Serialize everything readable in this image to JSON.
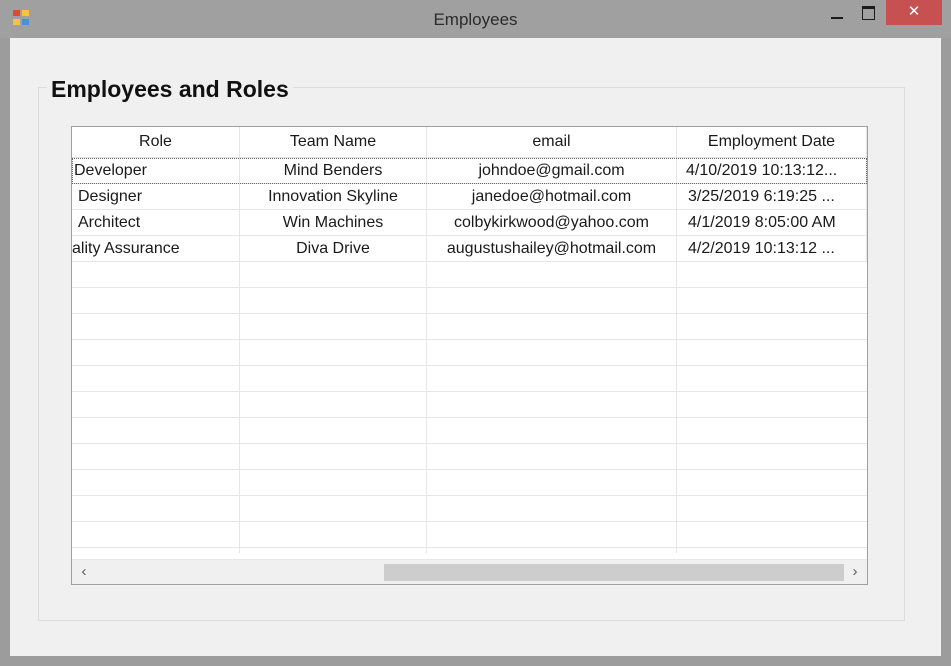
{
  "window": {
    "title": "Employees",
    "close_glyph": "✕",
    "icon": "app-window-icon"
  },
  "group": {
    "title": "Employees and Roles"
  },
  "grid": {
    "columns": [
      "Role",
      "Team Name",
      "email",
      "Employment Date"
    ],
    "rows": [
      [
        "Developer",
        "Mind Benders",
        "johndoe@gmail.com",
        "4/10/2019 10:13:12..."
      ],
      [
        "Designer",
        "Innovation Skyline",
        "janedoe@hotmail.com",
        "3/25/2019 6:19:25 ..."
      ],
      [
        "Architect",
        "Win Machines",
        "colbykirkwood@yahoo.com",
        "4/1/2019 8:05:00 AM"
      ],
      [
        "ality Assurance",
        "Diva Drive",
        "augustushailey@hotmail.com",
        "4/2/2019 10:13:12 ..."
      ]
    ],
    "empty_rows": 11
  },
  "scrollbar": {
    "left_arrow": "‹",
    "right_arrow": "›"
  },
  "colors": {
    "titlebar": "#a0a0a0",
    "close_button": "#c75050",
    "client_background": "#f0f0f0",
    "grid_background": "#ffffff"
  }
}
